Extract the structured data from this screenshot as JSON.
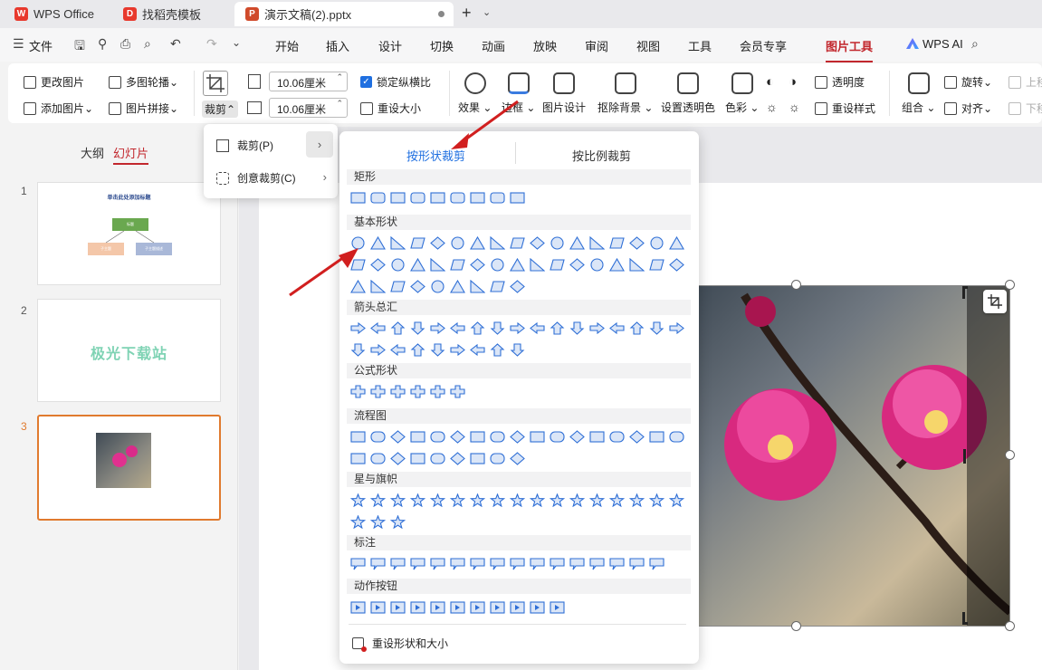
{
  "tabs": [
    {
      "label": "WPS Office",
      "logo": "W",
      "color": "#e8392d"
    },
    {
      "label": "找稻壳模板",
      "logo": "D",
      "color": "#e8392d"
    },
    {
      "label": "演示文稿(2).pptx",
      "logo": "P",
      "color": "#d04a2b"
    }
  ],
  "menu": {
    "file": "文件",
    "items": [
      "开始",
      "插入",
      "设计",
      "切换",
      "动画",
      "放映",
      "审阅",
      "视图",
      "工具",
      "会员专享",
      "图片工具"
    ],
    "active": "图片工具",
    "ai": "WPS AI"
  },
  "ribbon": {
    "change_picture": "更改图片",
    "add_picture": "添加图片",
    "multi_outline": "多图轮播",
    "picture_join": "图片拼接",
    "crop": "裁剪",
    "width_value": "10.06厘米",
    "height_value": "10.06厘米",
    "lock_ratio": "锁定纵横比",
    "reset_size": "重设大小",
    "effect": "效果",
    "border": "边框",
    "picture_design": "图片设计",
    "remove_bg": "抠除背景",
    "set_transparent": "设置透明色",
    "color": "色彩",
    "transparency": "透明度",
    "reset_style": "重设样式",
    "combine": "组合",
    "rotate": "旋转",
    "align": "对齐",
    "move_up": "上移",
    "move_down": "下移"
  },
  "left_panel": {
    "outline_tab": "大纲",
    "slides_tab": "幻灯片",
    "slides": [
      {
        "num": "1",
        "title": "单击此处添加标题",
        "box": "标题",
        "left": "子主题",
        "right": "子主题描述"
      },
      {
        "num": "2",
        "text": "极光下载站"
      },
      {
        "num": "3"
      }
    ]
  },
  "crop_menu": {
    "crop": "裁剪(P)",
    "creative_crop": "创意裁剪(C)"
  },
  "shape_menu": {
    "tab_shape": "按形状裁剪",
    "tab_ratio": "按比例裁剪",
    "categories": [
      "矩形",
      "基本形状",
      "箭头总汇",
      "公式形状",
      "流程图",
      "星与旗帜",
      "标注",
      "动作按钮"
    ],
    "reset": "重设形状和大小"
  },
  "colors": {
    "accent": "#c2272d",
    "shape_stroke": "#2f6fd6",
    "shape_fill": "#dbe6f7",
    "arrow": "#d11f1f"
  }
}
